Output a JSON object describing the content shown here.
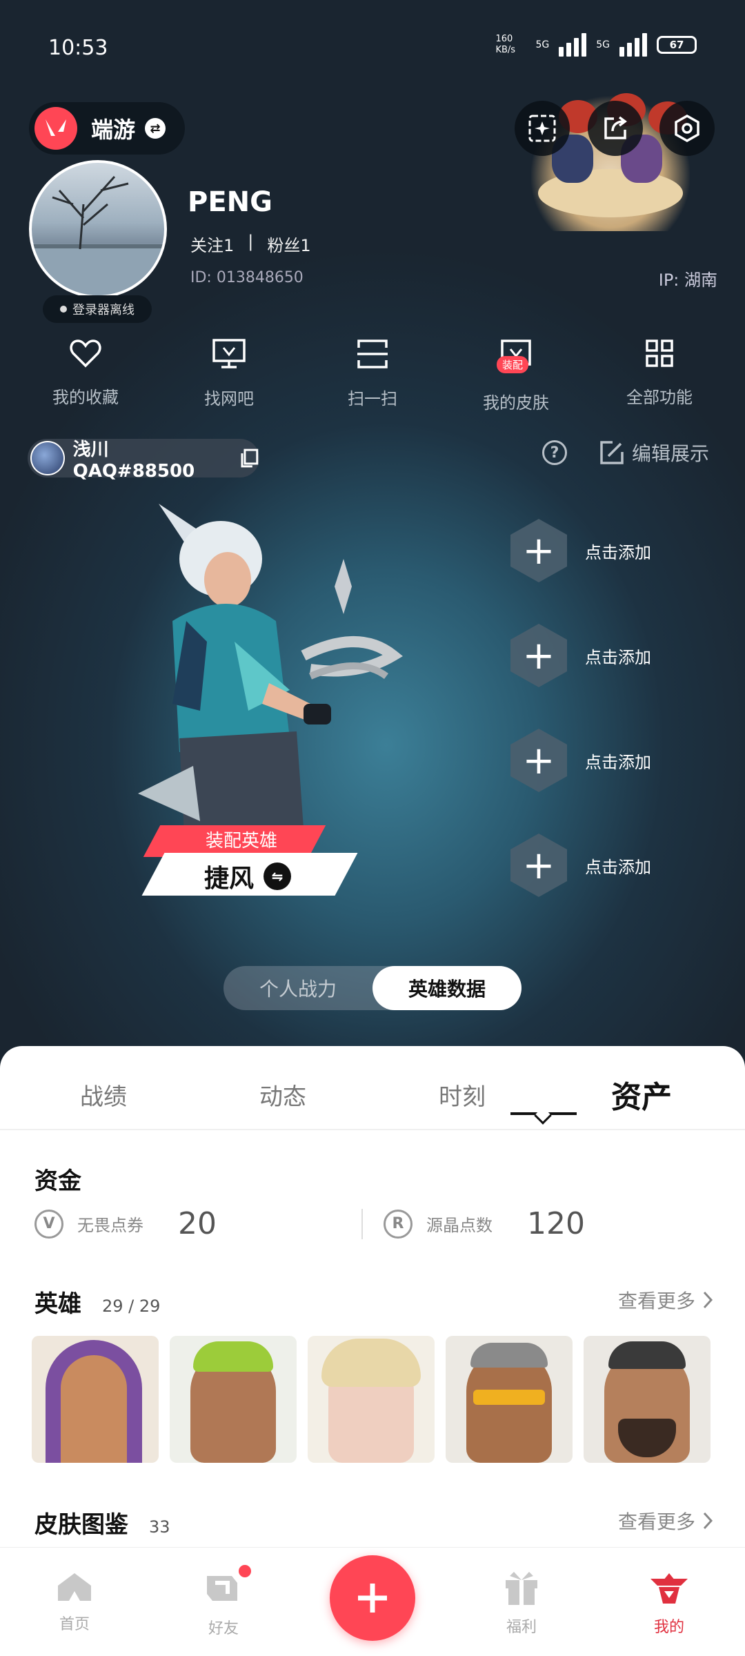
{
  "status_bar": {
    "time": "10:53",
    "net_speed": "160 KB/s",
    "sig1": "5G",
    "sig2": "5G",
    "battery": "67"
  },
  "header": {
    "game_name": "端游"
  },
  "profile": {
    "username": "PENG",
    "following_label": "关注1",
    "followers_label": "粉丝1",
    "separator": "|",
    "id_text": "ID: 013848650",
    "ip_text": "IP: 湖南",
    "online_status": "登录器离线"
  },
  "quick_actions": [
    {
      "label": "我的收藏",
      "icon": "heart-icon"
    },
    {
      "label": "找网吧",
      "icon": "monitor-icon"
    },
    {
      "label": "扫一扫",
      "icon": "scan-icon"
    },
    {
      "label": "我的皮肤",
      "icon": "skin-icon",
      "badge": "装配"
    },
    {
      "label": "全部功能",
      "icon": "grid-icon"
    }
  ],
  "player": {
    "riot_id": "浅川QAQ#88500",
    "edit_label": "编辑展示"
  },
  "showcase": {
    "tag": "装配英雄",
    "hero_name": "捷风",
    "slots": [
      "点击添加",
      "点击添加",
      "点击添加",
      "点击添加"
    ],
    "toggle_off": "个人战力",
    "toggle_on": "英雄数据"
  },
  "tabs": [
    "战绩",
    "动态",
    "时刻",
    "资产"
  ],
  "active_tab": "资产",
  "assets": {
    "funds_title": "资金",
    "vp_label": "无畏点券",
    "vp_value": "20",
    "rp_label": "源晶点数",
    "rp_value": "120",
    "heroes_title": "英雄",
    "heroes_count": "29 / 29",
    "more_label": "查看更多",
    "skins_title": "皮肤图鉴",
    "skins_count": "33"
  },
  "hero_cards": [
    {
      "name": "hero-portrait-1",
      "bg": "#7b4fa0",
      "skin": "#c98b5f"
    },
    {
      "name": "hero-portrait-2",
      "bg": "#9ccc3a",
      "skin": "#b07855"
    },
    {
      "name": "hero-portrait-3",
      "bg": "#e8d7a8",
      "skin": "#efcfc0"
    },
    {
      "name": "hero-portrait-4",
      "bg": "#8a8a8a",
      "skin": "#a8704a"
    },
    {
      "name": "hero-portrait-5",
      "bg": "#3a3a3a",
      "skin": "#b5805c"
    }
  ],
  "bottom_nav": {
    "home": "首页",
    "friends": "好友",
    "welfare": "福利",
    "mine": "我的"
  },
  "colors": {
    "accent": "#ff4655",
    "bg_dark": "#1a2530",
    "text_muted": "#888888"
  }
}
